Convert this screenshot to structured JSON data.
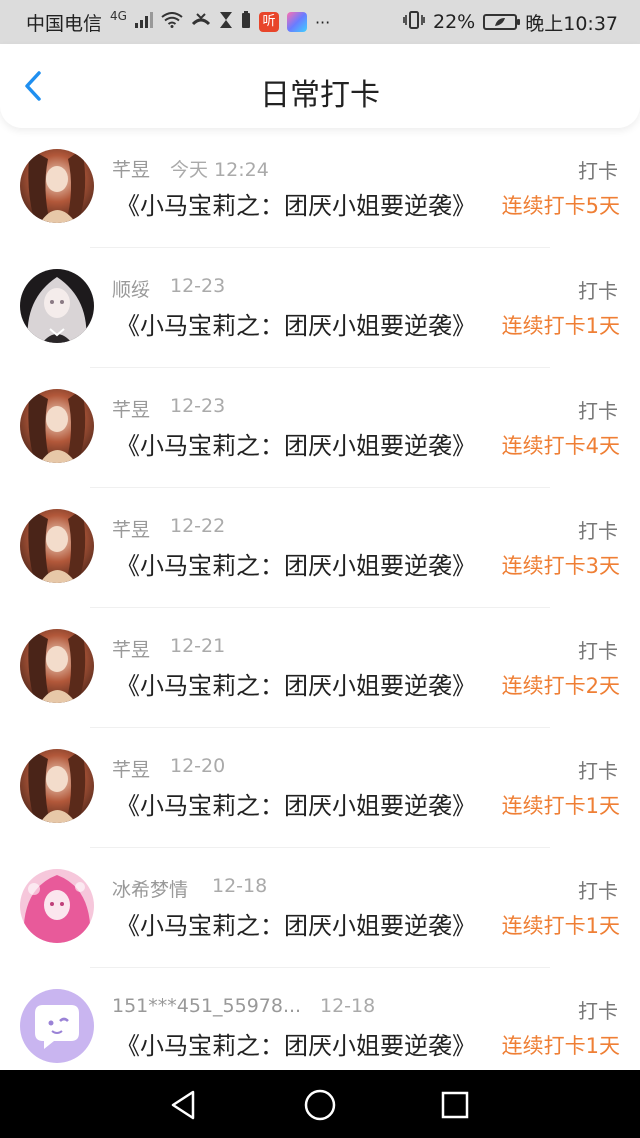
{
  "status_bar": {
    "carrier": "中国电信",
    "network": "4G",
    "badge_listen": "听",
    "more": "···",
    "battery": "22%",
    "time": "晚上10:37"
  },
  "header": {
    "title": "日常打卡"
  },
  "records": [
    {
      "user": "芊昱",
      "time": "今天 12:24",
      "book": "《小马宝莉之：团厌小姐要逆袭》",
      "action": "打卡",
      "streak": "连续打卡5天",
      "avatar": "anime-girl-red"
    },
    {
      "user": "顺绥",
      "time": "12-23",
      "book": "《小马宝莉之：团厌小姐要逆袭》",
      "action": "打卡",
      "streak": "连续打卡1天",
      "avatar": "anime-girl-white-hair"
    },
    {
      "user": "芊昱",
      "time": "12-23",
      "book": "《小马宝莉之：团厌小姐要逆袭》",
      "action": "打卡",
      "streak": "连续打卡4天",
      "avatar": "anime-girl-red"
    },
    {
      "user": "芊昱",
      "time": "12-22",
      "book": "《小马宝莉之：团厌小姐要逆袭》",
      "action": "打卡",
      "streak": "连续打卡3天",
      "avatar": "anime-girl-red"
    },
    {
      "user": "芊昱",
      "time": "12-21",
      "book": "《小马宝莉之：团厌小姐要逆袭》",
      "action": "打卡",
      "streak": "连续打卡2天",
      "avatar": "anime-girl-red"
    },
    {
      "user": "芊昱",
      "time": "12-20",
      "book": "《小马宝莉之：团厌小姐要逆袭》",
      "action": "打卡",
      "streak": "连续打卡1天",
      "avatar": "anime-girl-red"
    },
    {
      "user": "冰希梦情",
      "time": "12-18",
      "book": "《小马宝莉之：团厌小姐要逆袭》",
      "action": "打卡",
      "streak": "连续打卡1天",
      "avatar": "anime-girl-pink"
    },
    {
      "user": "151***451_55978...",
      "time": "12-18",
      "book": "《小马宝莉之：团厌小姐要逆袭》",
      "action": "打卡",
      "streak": "连续打卡1天",
      "avatar": "default-chat-avatar"
    }
  ],
  "colors": {
    "accent_blue": "#1f8ff0",
    "streak_orange": "#ef7f35",
    "status_bar_bg": "#dcdcdc"
  },
  "nav": {
    "back": "back-triangle-icon",
    "home": "home-circle-icon",
    "recents": "recents-square-icon"
  }
}
